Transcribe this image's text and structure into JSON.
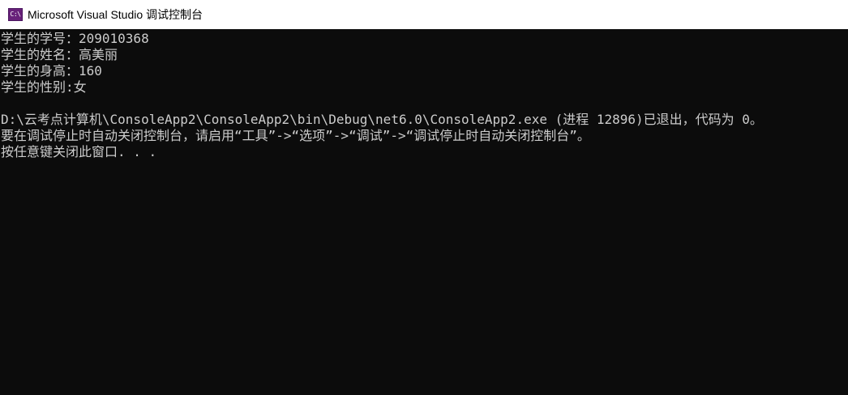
{
  "window": {
    "title": "Microsoft Visual Studio 调试控制台",
    "icon_text": "C:\\",
    "icon_color": "#68217a"
  },
  "console": {
    "background": "#0c0c0c",
    "foreground": "#cccccc",
    "lines": [
      "学生的学号：209010368",
      "学生的姓名：高美丽",
      "学生的身高：160",
      "学生的性别:女",
      "",
      "D:\\云考点计算机\\ConsoleApp2\\ConsoleApp2\\bin\\Debug\\net6.0\\ConsoleApp2.exe (进程 12896)已退出，代码为 0。",
      "要在调试停止时自动关闭控制台，请启用“工具”->“选项”->“调试”->“调试停止时自动关闭控制台”。",
      "按任意键关闭此窗口. . ."
    ]
  }
}
